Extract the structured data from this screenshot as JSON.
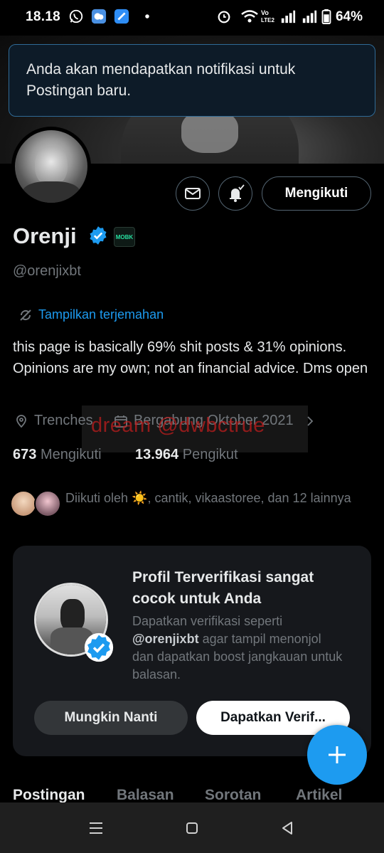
{
  "status_bar": {
    "time": "18.18",
    "battery": "64%",
    "icons": [
      "whatsapp-icon",
      "weather-icon",
      "app-icon",
      "dot-icon",
      "alarm-icon",
      "wifi-icon",
      "volte-icon",
      "signal-icon",
      "signal-icon",
      "battery-icon"
    ]
  },
  "toast": {
    "message": "Anda akan mendapatkan notifikasi untuk Postingan baru."
  },
  "profile": {
    "name": "Orenji",
    "handle": "@orenjixbt",
    "affiliate_badge": "MOBK",
    "translate_label": "Tampilkan terjemahan",
    "bio": "this page is basically 69% shit posts & 31% opinions. Opinions are my own; not an financial advice. Dms open",
    "location": "Trenches",
    "joined": "Bergabung Oktober 2021",
    "watermark": "dream @dwbctrue",
    "following_count": "673",
    "following_label": "Mengikuti",
    "followers_count": "13.964",
    "followers_label": "Pengikut",
    "followed_by": "Diikuti oleh ☀️, cantik, vikaastoree, dan 12 lainnya",
    "follow_button": "Mengikuti"
  },
  "verify_card": {
    "title": "Profil Terverifikasi sangat cocok untuk Anda",
    "desc_prefix": "Dapatkan verifikasi seperti",
    "desc_handle": "@orenjixbt",
    "desc_suffix": "agar tampil menonjol dan dapatkan boost jangkauan untuk balasan.",
    "later_button": "Mungkin Nanti",
    "verify_button": "Dapatkan Verif..."
  },
  "tabs": [
    "Postingan",
    "Balasan",
    "Sorotan",
    "Artikel"
  ],
  "colors": {
    "accent": "#1d9bf0",
    "background": "#000000",
    "muted_text": "#71767b",
    "card_bg": "#16181c"
  }
}
